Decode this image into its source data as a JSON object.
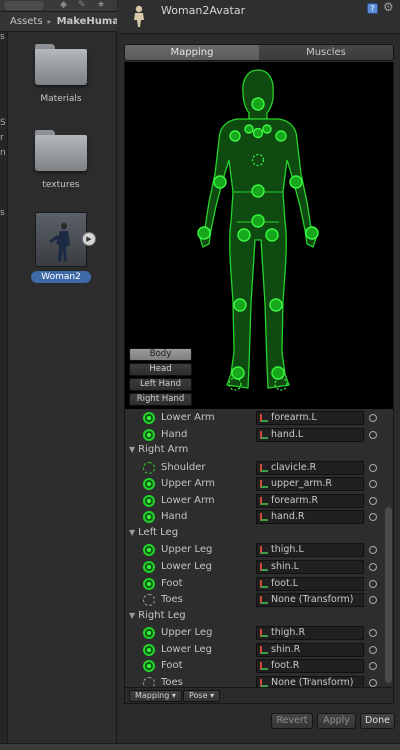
{
  "left_panel": {
    "breadcrumb": [
      "Assets",
      "MakeHuma"
    ],
    "assets": [
      {
        "name": "Materials",
        "type": "folder"
      },
      {
        "name": "textures",
        "type": "folder"
      },
      {
        "name": "Woman2",
        "type": "model",
        "selected": true
      }
    ]
  },
  "inspector": {
    "title": "Woman2Avatar",
    "tabs": [
      {
        "label": "Mapping",
        "active": true
      },
      {
        "label": "Muscles",
        "active": false
      }
    ],
    "body_part_buttons": [
      {
        "label": "Body",
        "active": true
      },
      {
        "label": "Head",
        "active": false
      },
      {
        "label": "Left Hand",
        "active": false
      },
      {
        "label": "Right Hand",
        "active": false
      }
    ],
    "bones": [
      {
        "kind": "bone",
        "name": "Lower Arm",
        "value": "forearm.L",
        "state": "mapped"
      },
      {
        "kind": "bone",
        "name": "Hand",
        "value": "hand.L",
        "state": "mapped"
      },
      {
        "kind": "group",
        "name": "Right Arm"
      },
      {
        "kind": "bone",
        "name": "Shoulder",
        "value": "clavicle.R",
        "state": "optional"
      },
      {
        "kind": "bone",
        "name": "Upper Arm",
        "value": "upper_arm.R",
        "state": "mapped"
      },
      {
        "kind": "bone",
        "name": "Lower Arm",
        "value": "forearm.R",
        "state": "mapped"
      },
      {
        "kind": "bone",
        "name": "Hand",
        "value": "hand.R",
        "state": "mapped"
      },
      {
        "kind": "group",
        "name": "Left Leg"
      },
      {
        "kind": "bone",
        "name": "Upper Leg",
        "value": "thigh.L",
        "state": "mapped"
      },
      {
        "kind": "bone",
        "name": "Lower Leg",
        "value": "shin.L",
        "state": "mapped"
      },
      {
        "kind": "bone",
        "name": "Foot",
        "value": "foot.L",
        "state": "mapped"
      },
      {
        "kind": "bone",
        "name": "Toes",
        "value": "None (Transform)",
        "state": "empty"
      },
      {
        "kind": "group",
        "name": "Right Leg"
      },
      {
        "kind": "bone",
        "name": "Upper Leg",
        "value": "thigh.R",
        "state": "mapped"
      },
      {
        "kind": "bone",
        "name": "Lower Leg",
        "value": "shin.R",
        "state": "mapped"
      },
      {
        "kind": "bone",
        "name": "Foot",
        "value": "foot.R",
        "state": "mapped"
      },
      {
        "kind": "bone",
        "name": "Toes",
        "value": "None (Transform)",
        "state": "empty"
      }
    ],
    "dropdowns": {
      "mapping": "Mapping ▾",
      "pose": "Pose ▾"
    },
    "buttons": {
      "revert": "Revert",
      "apply": "Apply",
      "done": "Done"
    }
  },
  "colors": {
    "mapped": "#22d12a",
    "accent": "#3e6aa8",
    "figure_fill": "#0f4a10"
  }
}
